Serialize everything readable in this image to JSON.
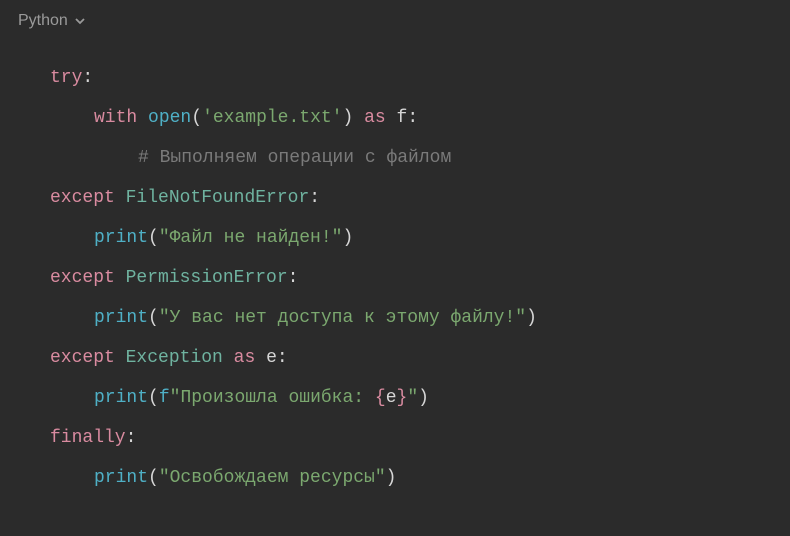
{
  "header": {
    "language": "Python"
  },
  "code": {
    "l1_try": "try",
    "l1_colon": ":",
    "l2_with": "with",
    "l2_open": "open",
    "l2_lp": "(",
    "l2_str": "'example.txt'",
    "l2_rp": ")",
    "l2_as": " as ",
    "l2_f": "f",
    "l2_colon": ":",
    "l3_comment": "# Выполняем операции с файлом",
    "l4_except": "except",
    "l4_sp": " ",
    "l4_cls": "FileNotFoundError",
    "l4_colon": ":",
    "l5_print": "print",
    "l5_lp": "(",
    "l5_str": "\"Файл не найден!\"",
    "l5_rp": ")",
    "l6_except": "except",
    "l6_sp": " ",
    "l6_cls": "PermissionError",
    "l6_colon": ":",
    "l7_print": "print",
    "l7_lp": "(",
    "l7_str": "\"У вас нет доступа к этому файлу!\"",
    "l7_rp": ")",
    "l8_except": "except",
    "l8_sp": " ",
    "l8_cls": "Exception",
    "l8_as": " as ",
    "l8_e": "e",
    "l8_colon": ":",
    "l9_print": "print",
    "l9_lp": "(",
    "l9_f": "f",
    "l9_str1": "\"Произошла ошибка: ",
    "l9_lb": "{",
    "l9_var": "e",
    "l9_rb": "}",
    "l9_str2": "\"",
    "l9_rp": ")",
    "l10_finally": "finally",
    "l10_colon": ":",
    "l11_print": "print",
    "l11_lp": "(",
    "l11_str": "\"Освобождаем ресурсы\"",
    "l11_rp": ")"
  }
}
